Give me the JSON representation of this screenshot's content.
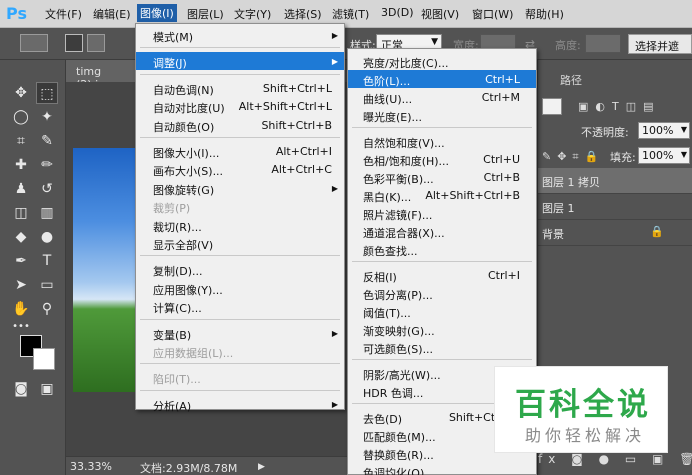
{
  "app_logo": "Ps",
  "menubar": {
    "items": [
      "文件(F)",
      "编辑(E)",
      "图像(I)",
      "图层(L)",
      "文字(Y)",
      "选择(S)",
      "滤镜(T)",
      "3D(D)",
      "视图(V)",
      "窗口(W)",
      "帮助(H)"
    ],
    "active": "图像(I)"
  },
  "options_bar": {
    "style_label": "样式:",
    "style_value": "正常",
    "width_label": "宽度:",
    "height_label": "高度:",
    "select_mask_button": "选择并遮"
  },
  "document": {
    "tab_title": "timg (2).jpg",
    "zoom": "33.33%",
    "doc_info": "文档:2.93M/8.78M"
  },
  "image_menu": {
    "items": [
      {
        "label": "模式(M)",
        "submenu": true
      },
      {
        "sep": true
      },
      {
        "label": "调整(J)",
        "submenu": true,
        "highlighted": true
      },
      {
        "sep": true
      },
      {
        "label": "自动色调(N)",
        "shortcut": "Shift+Ctrl+L"
      },
      {
        "label": "自动对比度(U)",
        "shortcut": "Alt+Shift+Ctrl+L"
      },
      {
        "label": "自动颜色(O)",
        "shortcut": "Shift+Ctrl+B"
      },
      {
        "sep": true
      },
      {
        "label": "图像大小(I)...",
        "shortcut": "Alt+Ctrl+I"
      },
      {
        "label": "画布大小(S)...",
        "shortcut": "Alt+Ctrl+C"
      },
      {
        "label": "图像旋转(G)",
        "submenu": true
      },
      {
        "label": "裁剪(P)",
        "disabled": true
      },
      {
        "label": "裁切(R)..."
      },
      {
        "label": "显示全部(V)"
      },
      {
        "sep": true
      },
      {
        "label": "复制(D)..."
      },
      {
        "label": "应用图像(Y)..."
      },
      {
        "label": "计算(C)..."
      },
      {
        "sep": true
      },
      {
        "label": "变量(B)",
        "submenu": true
      },
      {
        "label": "应用数据组(L)...",
        "disabled": true
      },
      {
        "sep": true
      },
      {
        "label": "陷印(T)...",
        "disabled": true
      },
      {
        "sep": true
      },
      {
        "label": "分析(A)",
        "submenu": true
      }
    ]
  },
  "adjust_menu": {
    "items": [
      {
        "label": "亮度/对比度(C)..."
      },
      {
        "label": "色阶(L)...",
        "shortcut": "Ctrl+L",
        "highlighted": true
      },
      {
        "label": "曲线(U)...",
        "shortcut": "Ctrl+M"
      },
      {
        "label": "曝光度(E)..."
      },
      {
        "sep": true
      },
      {
        "label": "自然饱和度(V)..."
      },
      {
        "label": "色相/饱和度(H)...",
        "shortcut": "Ctrl+U"
      },
      {
        "label": "色彩平衡(B)...",
        "shortcut": "Ctrl+B"
      },
      {
        "label": "黑白(K)...",
        "shortcut": "Alt+Shift+Ctrl+B"
      },
      {
        "label": "照片滤镜(F)..."
      },
      {
        "label": "通道混合器(X)..."
      },
      {
        "label": "颜色查找..."
      },
      {
        "sep": true
      },
      {
        "label": "反相(I)",
        "shortcut": "Ctrl+I"
      },
      {
        "label": "色调分离(P)..."
      },
      {
        "label": "阈值(T)..."
      },
      {
        "label": "渐变映射(G)..."
      },
      {
        "label": "可选颜色(S)..."
      },
      {
        "sep": true
      },
      {
        "label": "阴影/高光(W)..."
      },
      {
        "label": "HDR 色调..."
      },
      {
        "sep": true
      },
      {
        "label": "去色(D)",
        "shortcut": "Shift+Ctrl+U"
      },
      {
        "label": "匹配颜色(M)..."
      },
      {
        "label": "替换颜色(R)..."
      },
      {
        "label": "色调均化(Q)"
      }
    ]
  },
  "panels": {
    "tab_paths": "路径",
    "opacity_label": "不透明度:",
    "opacity_value": "100%",
    "fill_label": "填充:",
    "fill_value": "100%",
    "layers": [
      {
        "name": "图层 1 拷贝",
        "selected": true
      },
      {
        "name": "图层 1"
      },
      {
        "name": "背景",
        "locked": true
      }
    ]
  },
  "watermark": {
    "title": "百科全说",
    "subtitle": "助你轻松解决"
  },
  "colors": {
    "menu_highlight": "#1e7ad6",
    "ps_blue": "#31a8ff",
    "watermark_green": "#2ea84b"
  }
}
